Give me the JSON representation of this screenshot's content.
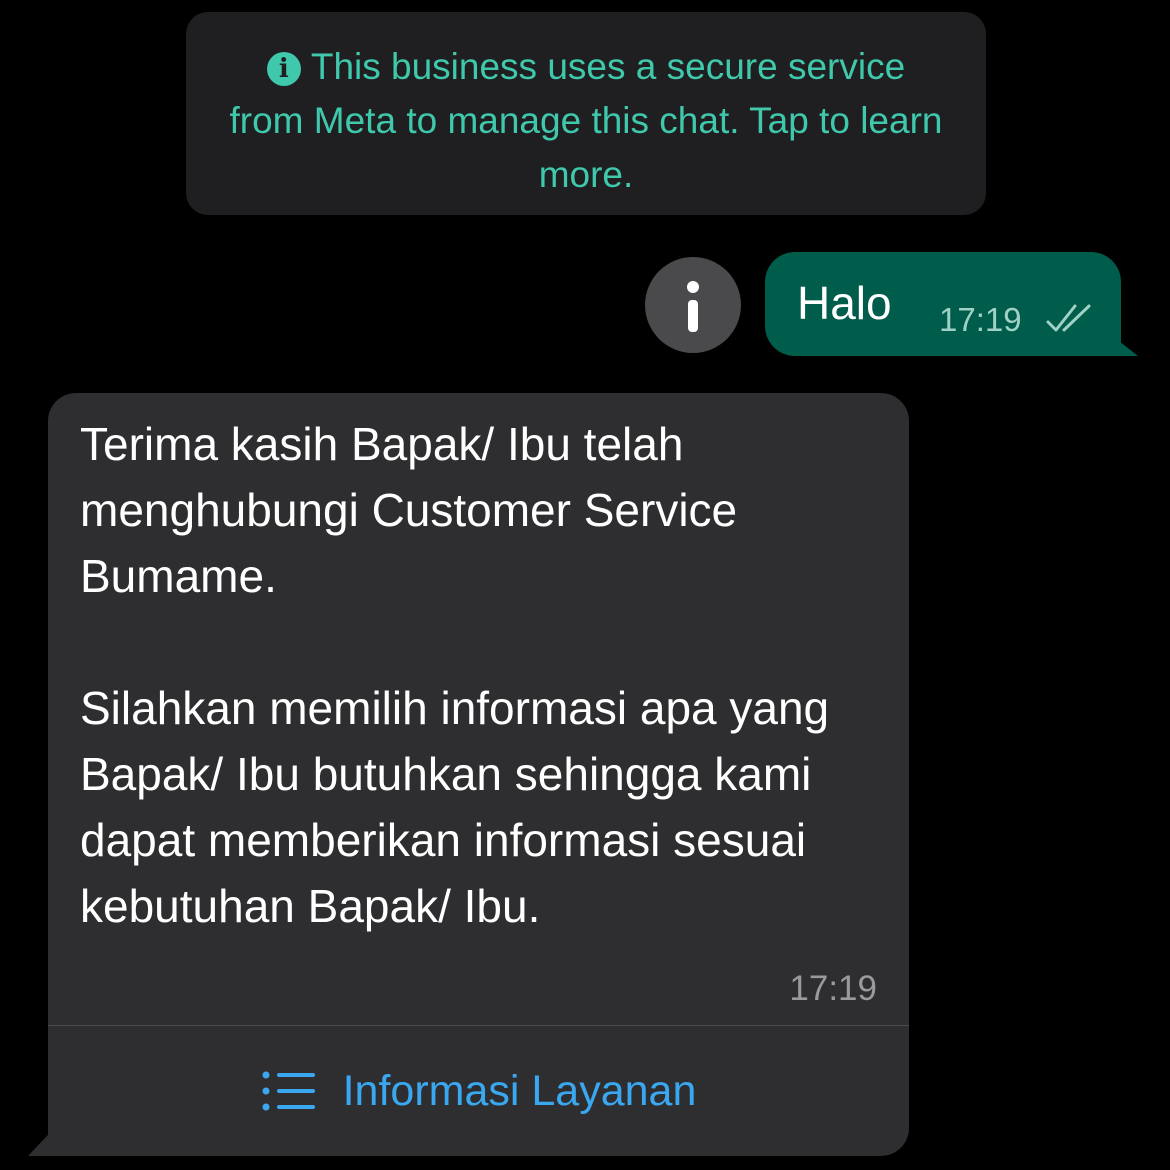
{
  "notice": {
    "icon": "info-icon",
    "icon_glyph": "i",
    "text": "This business uses a secure service from Meta to manage this chat. Tap to learn more."
  },
  "outgoing": {
    "side_icon": "info-icon",
    "text": "Halo",
    "time": "17:19",
    "status_icon": "double-check-icon"
  },
  "incoming": {
    "paragraph1": "Terima kasih Bapak/ Ibu telah menghubungi Customer Service Bumame.",
    "paragraph2": "Silahkan memilih informasi apa yang Bapak/ Ibu butuhkan sehingga kami dapat memberikan informasi sesuai kebutuhan Bapak/ Ibu.",
    "time": "17:19",
    "action": {
      "icon": "list-icon",
      "label": "Informasi Layanan"
    }
  },
  "colors": {
    "background": "#000000",
    "notice_bg": "#1f1f21",
    "notice_text": "#3fc8ab",
    "outgoing_bubble": "#005c4b",
    "incoming_bubble": "#2e2e30",
    "link_blue": "#3aa8f0"
  }
}
